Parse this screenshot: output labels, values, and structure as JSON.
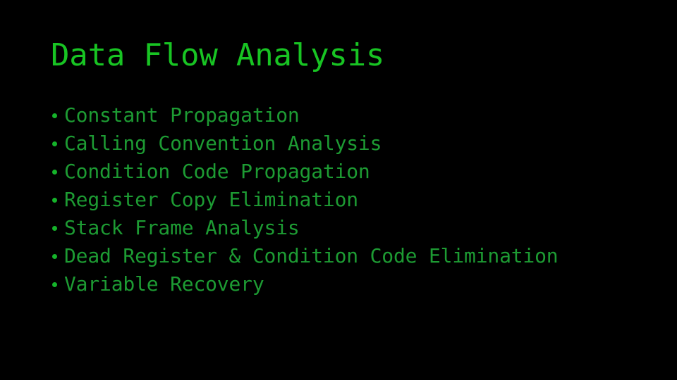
{
  "slide": {
    "background_color": "#000000",
    "title": "Data Flow Analysis",
    "title_color": "#18c423",
    "body_color": "#1d9b33",
    "bullet_marker_color": "#15b32a",
    "bullet_marker_icon": "filled-circle-icon",
    "bullets": [
      {
        "label": "Constant Propagation"
      },
      {
        "label": "Calling Convention Analysis"
      },
      {
        "label": "Condition Code Propagation"
      },
      {
        "label": "Register Copy Elimination"
      },
      {
        "label": "Stack Frame Analysis"
      },
      {
        "label": "Dead Register & Condition Code Elimination"
      },
      {
        "label": "Variable Recovery"
      }
    ]
  }
}
